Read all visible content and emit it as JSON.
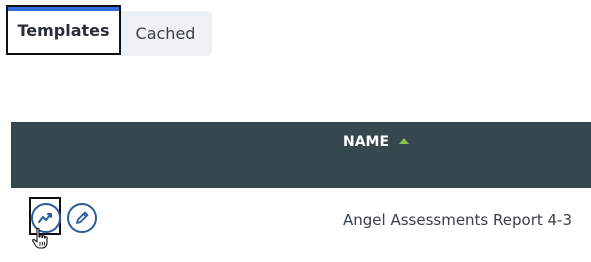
{
  "tabs": [
    {
      "label": "Templates",
      "active": true
    },
    {
      "label": "Cached",
      "active": false
    }
  ],
  "table": {
    "columns": [
      {
        "label": "NAME",
        "sort": "ascending"
      }
    ],
    "rows": [
      {
        "name": "Angel Assessments Report 4-3"
      }
    ]
  },
  "icons": {
    "report": "trend-line-icon",
    "edit": "pencil-icon",
    "cursor": "hand-pointer-icon"
  },
  "colors": {
    "active_tab_accent": "#2f6ee0",
    "table_header_bg": "#37474f",
    "sort_indicator": "#8bc34a",
    "action_icon": "#2c5d9a"
  }
}
